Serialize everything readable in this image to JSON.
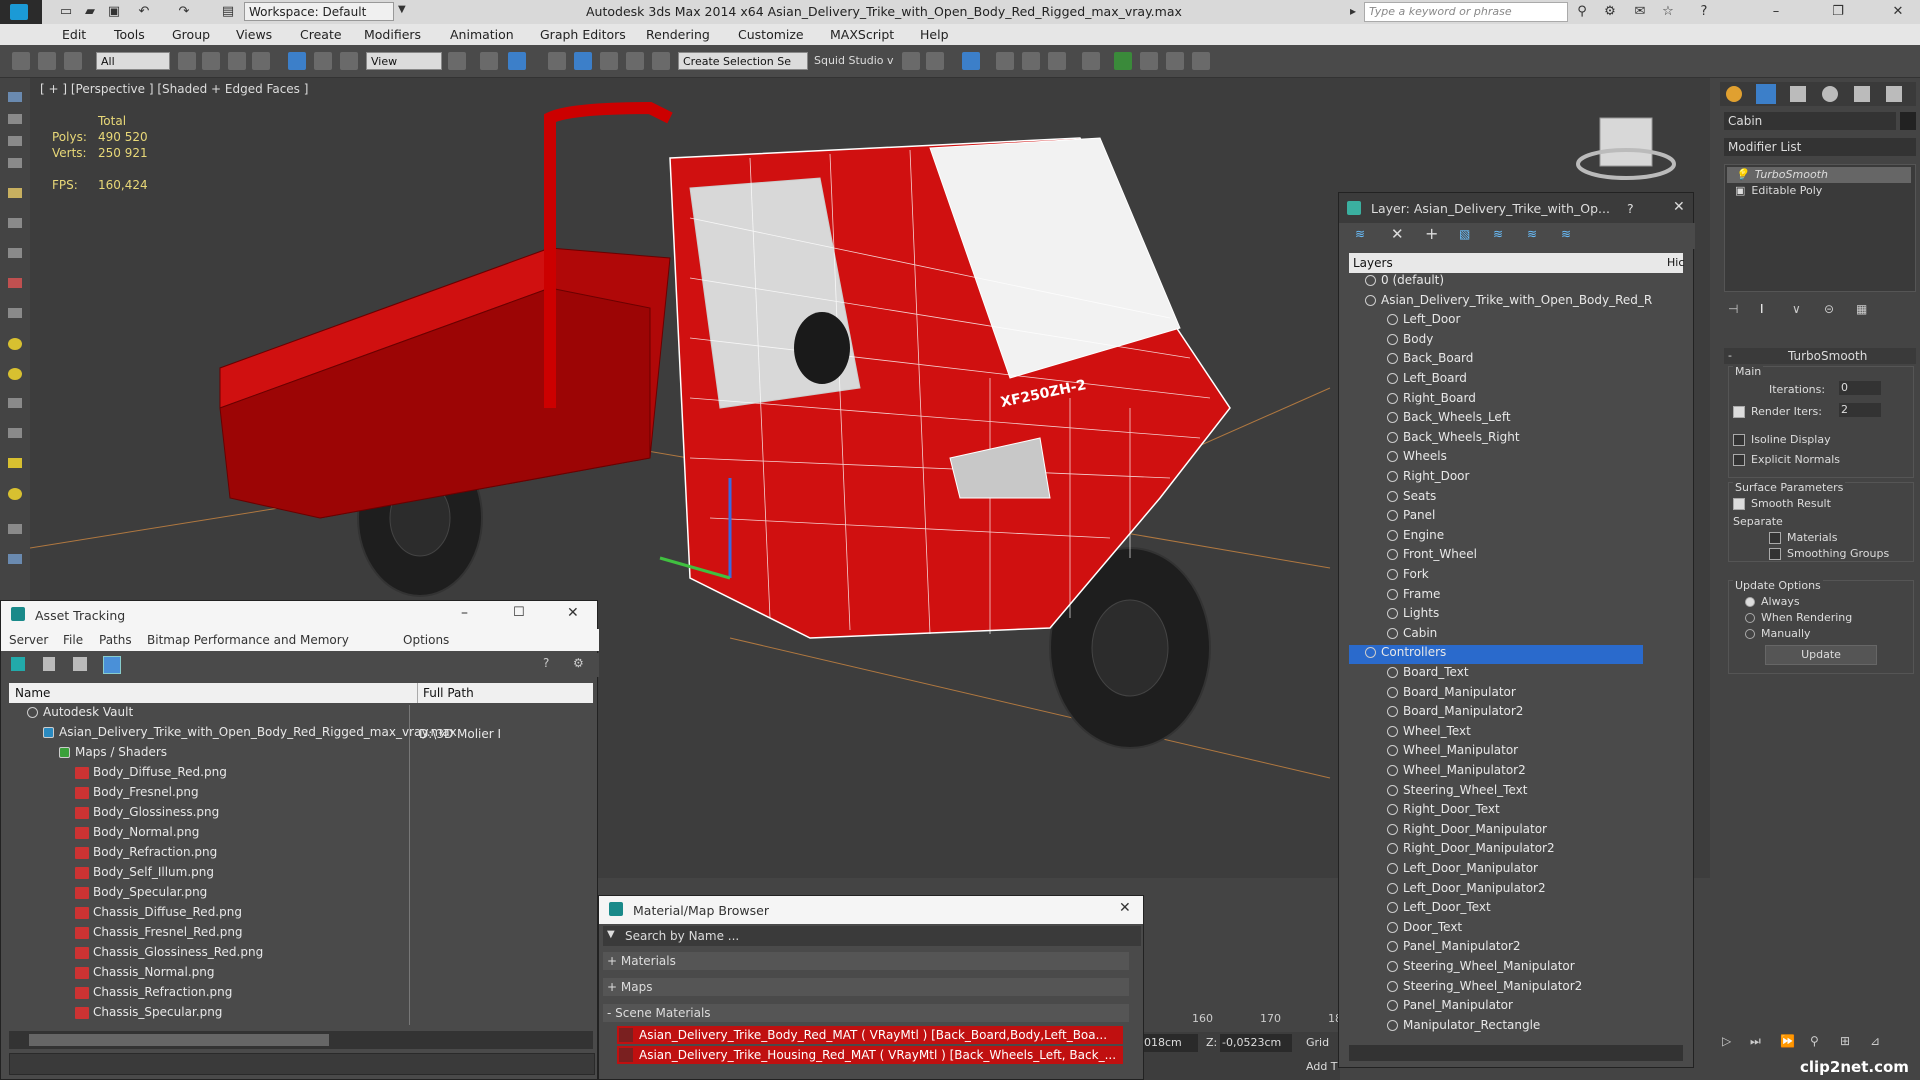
{
  "app": {
    "workspace": "Workspace: Default",
    "title": "Autodesk 3ds Max  2014 x64     Asian_Delivery_Trike_with_Open_Body_Red_Rigged_max_vray.max",
    "search_placeholder": "Type a keyword or phrase"
  },
  "menu": [
    "Edit",
    "Tools",
    "Group",
    "Views",
    "Create",
    "Modifiers",
    "Animation",
    "Graph Editors",
    "Rendering",
    "Customize",
    "MAXScript",
    "Help"
  ],
  "toolbar": {
    "filter": "All",
    "ref_coord": "View",
    "selection_set": "Create Selection Se",
    "studio": "Squid Studio v"
  },
  "viewport": {
    "label": "[ + ] [Perspective ] [Shaded + Edged Faces ]",
    "stats_header": "Total",
    "polys_label": "Polys:",
    "polys": "490 520",
    "verts_label": "Verts:",
    "verts": "250 921",
    "fps_label": "FPS:",
    "fps": "160,424",
    "plate": "XF250ZH-2"
  },
  "layer_panel": {
    "title": "Layer: Asian_Delivery_Trike_with_Op...",
    "help": "?",
    "col_layers": "Layers",
    "col_hide": "Hic",
    "rows": [
      {
        "label": "0 (default)",
        "indent": 0,
        "type": "layer"
      },
      {
        "label": "Asian_Delivery_Trike_with_Open_Body_Red_R",
        "indent": 0,
        "type": "layer"
      },
      {
        "label": "Left_Door",
        "indent": 1,
        "type": "obj"
      },
      {
        "label": "Body",
        "indent": 1,
        "type": "obj"
      },
      {
        "label": "Back_Board",
        "indent": 1,
        "type": "obj"
      },
      {
        "label": "Left_Board",
        "indent": 1,
        "type": "obj"
      },
      {
        "label": "Right_Board",
        "indent": 1,
        "type": "obj"
      },
      {
        "label": "Back_Wheels_Left",
        "indent": 1,
        "type": "obj"
      },
      {
        "label": "Back_Wheels_Right",
        "indent": 1,
        "type": "obj"
      },
      {
        "label": "Wheels",
        "indent": 1,
        "type": "obj"
      },
      {
        "label": "Right_Door",
        "indent": 1,
        "type": "obj"
      },
      {
        "label": "Seats",
        "indent": 1,
        "type": "obj"
      },
      {
        "label": "Panel",
        "indent": 1,
        "type": "obj"
      },
      {
        "label": "Engine",
        "indent": 1,
        "type": "obj"
      },
      {
        "label": "Front_Wheel",
        "indent": 1,
        "type": "obj"
      },
      {
        "label": "Fork",
        "indent": 1,
        "type": "obj"
      },
      {
        "label": "Frame",
        "indent": 1,
        "type": "obj"
      },
      {
        "label": "Lights",
        "indent": 1,
        "type": "obj"
      },
      {
        "label": "Cabin",
        "indent": 1,
        "type": "obj"
      },
      {
        "label": "Controllers",
        "indent": 0,
        "type": "layer",
        "selected": true
      },
      {
        "label": "Board_Text",
        "indent": 1,
        "type": "obj"
      },
      {
        "label": "Board_Manipulator",
        "indent": 1,
        "type": "obj"
      },
      {
        "label": "Board_Manipulator2",
        "indent": 1,
        "type": "obj"
      },
      {
        "label": "Wheel_Text",
        "indent": 1,
        "type": "obj"
      },
      {
        "label": "Wheel_Manipulator",
        "indent": 1,
        "type": "obj"
      },
      {
        "label": "Wheel_Manipulator2",
        "indent": 1,
        "type": "obj"
      },
      {
        "label": "Steering_Wheel_Text",
        "indent": 1,
        "type": "obj"
      },
      {
        "label": "Right_Door_Text",
        "indent": 1,
        "type": "obj"
      },
      {
        "label": "Right_Door_Manipulator",
        "indent": 1,
        "type": "obj"
      },
      {
        "label": "Right_Door_Manipulator2",
        "indent": 1,
        "type": "obj"
      },
      {
        "label": "Left_Door_Manipulator",
        "indent": 1,
        "type": "obj"
      },
      {
        "label": "Left_Door_Manipulator2",
        "indent": 1,
        "type": "obj"
      },
      {
        "label": "Left_Door_Text",
        "indent": 1,
        "type": "obj"
      },
      {
        "label": "Door_Text",
        "indent": 1,
        "type": "obj"
      },
      {
        "label": "Panel_Manipulator2",
        "indent": 1,
        "type": "obj"
      },
      {
        "label": "Steering_Wheel_Manipulator",
        "indent": 1,
        "type": "obj"
      },
      {
        "label": "Steering_Wheel_Manipulator2",
        "indent": 1,
        "type": "obj"
      },
      {
        "label": "Panel_Manipulator",
        "indent": 1,
        "type": "obj"
      },
      {
        "label": "Manipulator_Rectangle",
        "indent": 1,
        "type": "obj"
      }
    ]
  },
  "asset_panel": {
    "title": "Asset Tracking",
    "menu": [
      "Server",
      "File",
      "Paths",
      "Bitmap Performance and Memory",
      "Options"
    ],
    "col_name": "Name",
    "col_path": "Full Path",
    "rows": [
      {
        "label": "Autodesk Vault",
        "indent": 0,
        "type": "vault",
        "path": ""
      },
      {
        "label": "Asian_Delivery_Trike_with_Open_Body_Red_Rigged_max_vray.max",
        "indent": 1,
        "type": "max",
        "path": "D:\\3D Molier I"
      },
      {
        "label": "Maps / Shaders",
        "indent": 2,
        "type": "maps",
        "path": ""
      },
      {
        "label": "Body_Diffuse_Red.png",
        "indent": 3,
        "type": "png",
        "path": ""
      },
      {
        "label": "Body_Fresnel.png",
        "indent": 3,
        "type": "png",
        "path": ""
      },
      {
        "label": "Body_Glossiness.png",
        "indent": 3,
        "type": "png",
        "path": ""
      },
      {
        "label": "Body_Normal.png",
        "indent": 3,
        "type": "png",
        "path": ""
      },
      {
        "label": "Body_Refraction.png",
        "indent": 3,
        "type": "png",
        "path": ""
      },
      {
        "label": "Body_Self_Illum.png",
        "indent": 3,
        "type": "png",
        "path": ""
      },
      {
        "label": "Body_Specular.png",
        "indent": 3,
        "type": "png",
        "path": ""
      },
      {
        "label": "Chassis_Diffuse_Red.png",
        "indent": 3,
        "type": "png",
        "path": ""
      },
      {
        "label": "Chassis_Fresnel_Red.png",
        "indent": 3,
        "type": "png",
        "path": ""
      },
      {
        "label": "Chassis_Glossiness_Red.png",
        "indent": 3,
        "type": "png",
        "path": ""
      },
      {
        "label": "Chassis_Normal.png",
        "indent": 3,
        "type": "png",
        "path": ""
      },
      {
        "label": "Chassis_Refraction.png",
        "indent": 3,
        "type": "png",
        "path": ""
      },
      {
        "label": "Chassis_Specular.png",
        "indent": 3,
        "type": "png",
        "path": ""
      }
    ]
  },
  "material_panel": {
    "title": "Material/Map Browser",
    "search_placeholder": "Search by Name ...",
    "sections": [
      "+ Materials",
      "+ Maps",
      "- Scene Materials"
    ],
    "items": [
      "Asian_Delivery_Trike_Body_Red_MAT ( VRayMtl ) [Back_Board,Body,Left_Boa...",
      "Asian_Delivery_Trike_Housing_Red_MAT ( VRayMtl ) [Back_Wheels_Left, Back_..."
    ]
  },
  "command_panel": {
    "object_name": "Cabin",
    "modifier_list": "Modifier List",
    "stack": [
      "TurboSmooth",
      "Editable Poly"
    ],
    "rollout_title": "TurboSmooth",
    "main_label": "Main",
    "iterations_label": "Iterations:",
    "iterations": "0",
    "render_iters_label": "Render Iters:",
    "render_iters": "2",
    "isoline": "Isoline Display",
    "explicit_normals": "Explicit Normals",
    "surface_params": "Surface Parameters",
    "smooth_result": "Smooth Result",
    "separate": "Separate",
    "materials": "Materials",
    "smoothing_groups": "Smoothing Groups",
    "update_options": "Update Options",
    "always": "Always",
    "when_rendering": "When Rendering",
    "manually": "Manually",
    "update_button": "Update"
  },
  "timeline": {
    "ticks": [
      "160",
      "170",
      "18"
    ]
  },
  "status": {
    "x_value": "018cm",
    "z_label": "Z:",
    "z_value": "-0,0523cm",
    "grid": "Grid",
    "addtime": "Add T"
  },
  "watermark": "clip2net.com"
}
